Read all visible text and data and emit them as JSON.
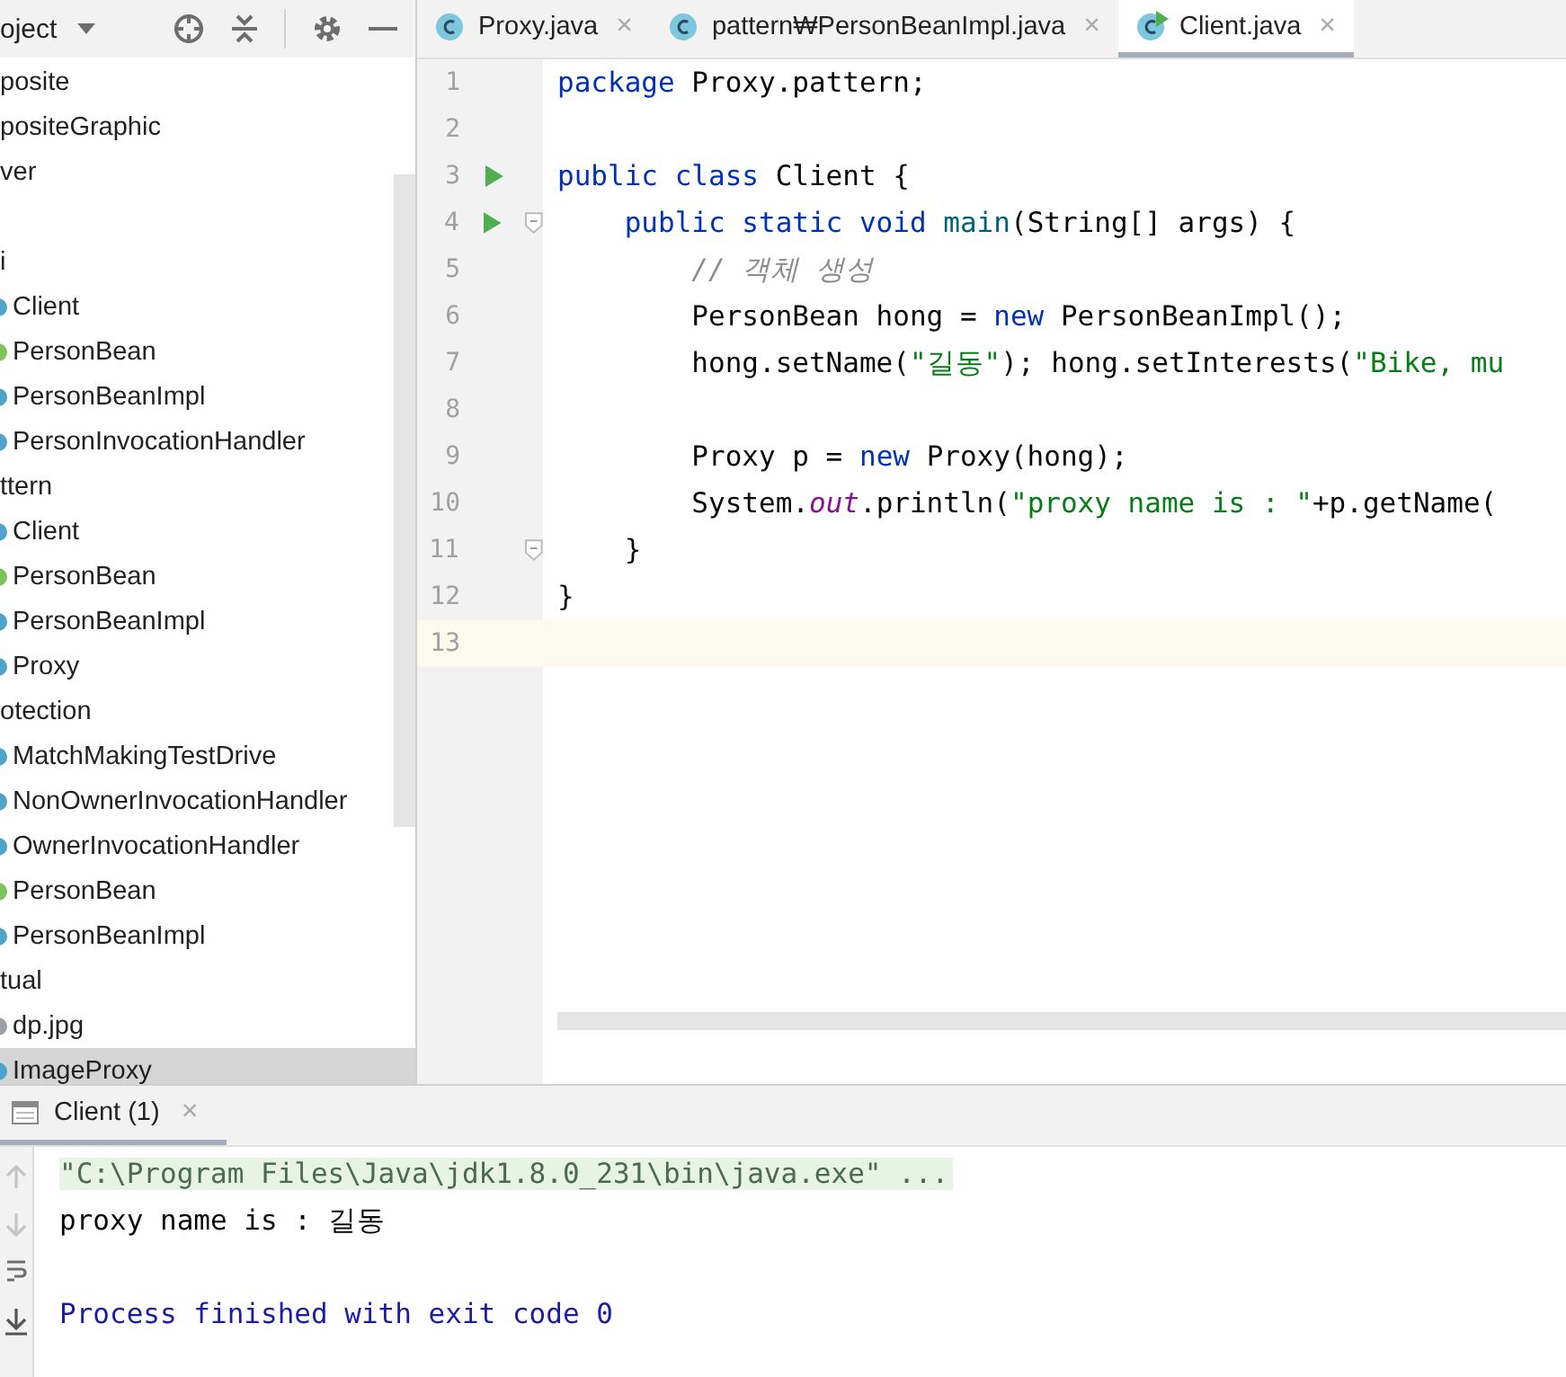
{
  "project_panel": {
    "title": "oject",
    "items": [
      {
        "label": "posite",
        "kind": "package",
        "selected": false
      },
      {
        "label": "positeGraphic",
        "kind": "package",
        "selected": false
      },
      {
        "label": "ver",
        "kind": "package",
        "selected": false
      },
      {
        "label": "i",
        "kind": "package",
        "selected": false
      },
      {
        "label": "Client",
        "kind": "main",
        "selected": false
      },
      {
        "label": "PersonBean",
        "kind": "interface",
        "selected": false
      },
      {
        "label": "PersonBeanImpl",
        "kind": "class",
        "selected": false
      },
      {
        "label": "PersonInvocationHandler",
        "kind": "class",
        "selected": false
      },
      {
        "label": "ttern",
        "kind": "package",
        "selected": false
      },
      {
        "label": "Client",
        "kind": "main",
        "selected": false
      },
      {
        "label": "PersonBean",
        "kind": "interface",
        "selected": false
      },
      {
        "label": "PersonBeanImpl",
        "kind": "class",
        "selected": false
      },
      {
        "label": "Proxy",
        "kind": "class",
        "selected": false
      },
      {
        "label": "otection",
        "kind": "package",
        "selected": false
      },
      {
        "label": "MatchMakingTestDrive",
        "kind": "main",
        "selected": false
      },
      {
        "label": "NonOwnerInvocationHandler",
        "kind": "class",
        "selected": false
      },
      {
        "label": "OwnerInvocationHandler",
        "kind": "class",
        "selected": false
      },
      {
        "label": "PersonBean",
        "kind": "interface",
        "selected": false
      },
      {
        "label": "PersonBeanImpl",
        "kind": "class",
        "selected": false
      },
      {
        "label": "tual",
        "kind": "package",
        "selected": false
      },
      {
        "label": "dp.jpg",
        "kind": "file",
        "selected": false
      },
      {
        "label": "ImageProxy",
        "kind": "class",
        "selected": true
      }
    ]
  },
  "editor": {
    "tabs": [
      {
        "label": "Proxy.java",
        "close": "×",
        "selected": false,
        "runnable": false
      },
      {
        "label": "pattern₩PersonBeanImpl.java",
        "close": "×",
        "selected": false,
        "runnable": false
      },
      {
        "label": "Client.java",
        "close": "×",
        "selected": true,
        "runnable": true
      }
    ],
    "lines": [
      {
        "number": "1",
        "tokens": [
          {
            "kind": "kw",
            "text": "package"
          },
          {
            "kind": "plain",
            "text": " Proxy.pattern;"
          }
        ]
      },
      {
        "number": "2"
      },
      {
        "number": "3",
        "run": true,
        "tokens": [
          {
            "kind": "kw",
            "text": "public class"
          },
          {
            "kind": "plain",
            "text": " Client {"
          }
        ]
      },
      {
        "number": "4",
        "run": true,
        "fold": true,
        "tokens": [
          {
            "kind": "kw",
            "text": "    public static void"
          },
          {
            "kind": "fn",
            "text": " main"
          },
          {
            "kind": "plain",
            "text": "(String[] args) {"
          }
        ]
      },
      {
        "number": "5",
        "tokens": [
          {
            "kind": "comment",
            "text": "        // 객체 생성"
          }
        ]
      },
      {
        "number": "6",
        "tokens": [
          {
            "kind": "plain",
            "text": "        PersonBean hong = "
          },
          {
            "kind": "kw",
            "text": "new"
          },
          {
            "kind": "plain",
            "text": " PersonBeanImpl();"
          }
        ]
      },
      {
        "number": "7",
        "tokens": [
          {
            "kind": "plain",
            "text": "        hong.setName("
          },
          {
            "kind": "str",
            "text": "\"길동\""
          },
          {
            "kind": "plain",
            "text": "); hong.setInterests("
          },
          {
            "kind": "str",
            "text": "\"Bike, mu"
          }
        ]
      },
      {
        "number": "8"
      },
      {
        "number": "9",
        "tokens": [
          {
            "kind": "plain",
            "text": "        Proxy p = "
          },
          {
            "kind": "kw",
            "text": "new"
          },
          {
            "kind": "plain",
            "text": " Proxy(hong);"
          }
        ]
      },
      {
        "number": "10",
        "tokens": [
          {
            "kind": "plain",
            "text": "        System."
          },
          {
            "kind": "static",
            "text": "out"
          },
          {
            "kind": "plain",
            "text": ".println("
          },
          {
            "kind": "str",
            "text": "\"proxy name is : \""
          },
          {
            "kind": "plain",
            "text": "+p.getName("
          }
        ]
      },
      {
        "number": "11",
        "fold": true,
        "tokens": [
          {
            "kind": "plain",
            "text": "    }"
          }
        ]
      },
      {
        "number": "12",
        "tokens": [
          {
            "kind": "plain",
            "text": "}"
          }
        ]
      },
      {
        "number": "13",
        "current": true
      }
    ]
  },
  "run_panel": {
    "tab": {
      "label": "Client (1)",
      "close": "×",
      "selected": true
    },
    "lines": [
      {
        "kind": "command",
        "text": "\"C:\\Program Files\\Java\\jdk1.8.0_231\\bin\\java.exe\" ..."
      },
      {
        "kind": "output",
        "text": "proxy name is : 길동"
      },
      {
        "kind": "blank"
      },
      {
        "kind": "exit",
        "text": "Process finished with exit code 0"
      }
    ]
  }
}
